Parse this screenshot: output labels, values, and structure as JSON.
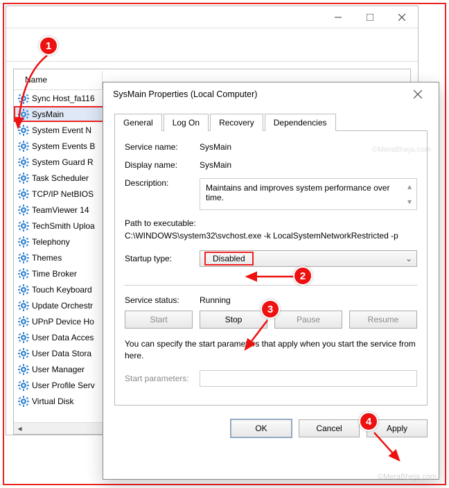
{
  "outer": {
    "header_col": "Name",
    "items": [
      "Sync Host_fa116",
      "SysMain",
      "System Event N",
      "System Events B",
      "System Guard R",
      "Task Scheduler",
      "TCP/IP NetBIOS",
      "TeamViewer 14",
      "TechSmith Uploa",
      "Telephony",
      "Themes",
      "Time Broker",
      "Touch Keyboard",
      "Update Orchestr",
      "UPnP Device Ho",
      "User Data Acces",
      "User Data Stora",
      "User Manager",
      "User Profile Serv",
      "Virtual Disk"
    ],
    "selected_index": 1
  },
  "dialog": {
    "title": "SysMain Properties (Local Computer)",
    "tabs": [
      "General",
      "Log On",
      "Recovery",
      "Dependencies"
    ],
    "active_tab": 0,
    "labels": {
      "service_name": "Service name:",
      "display_name": "Display name:",
      "description": "Description:",
      "path": "Path to executable:",
      "startup": "Startup type:",
      "status": "Service status:",
      "parameters": "Start parameters:"
    },
    "values": {
      "service_name": "SysMain",
      "display_name": "SysMain",
      "description": "Maintains and improves system performance over time.",
      "path": "C:\\WINDOWS\\system32\\svchost.exe -k LocalSystemNetworkRestricted -p",
      "startup": "Disabled",
      "status": "Running"
    },
    "buttons": {
      "start": "Start",
      "stop": "Stop",
      "pause": "Pause",
      "resume": "Resume"
    },
    "note": "You can specify the start parameters that apply when you start the service from here.",
    "footer": {
      "ok": "OK",
      "cancel": "Cancel",
      "apply": "Apply"
    }
  },
  "callouts": {
    "c1": "1",
    "c2": "2",
    "c3": "3",
    "c4": "4"
  },
  "watermark": "©MeraBheja.com"
}
